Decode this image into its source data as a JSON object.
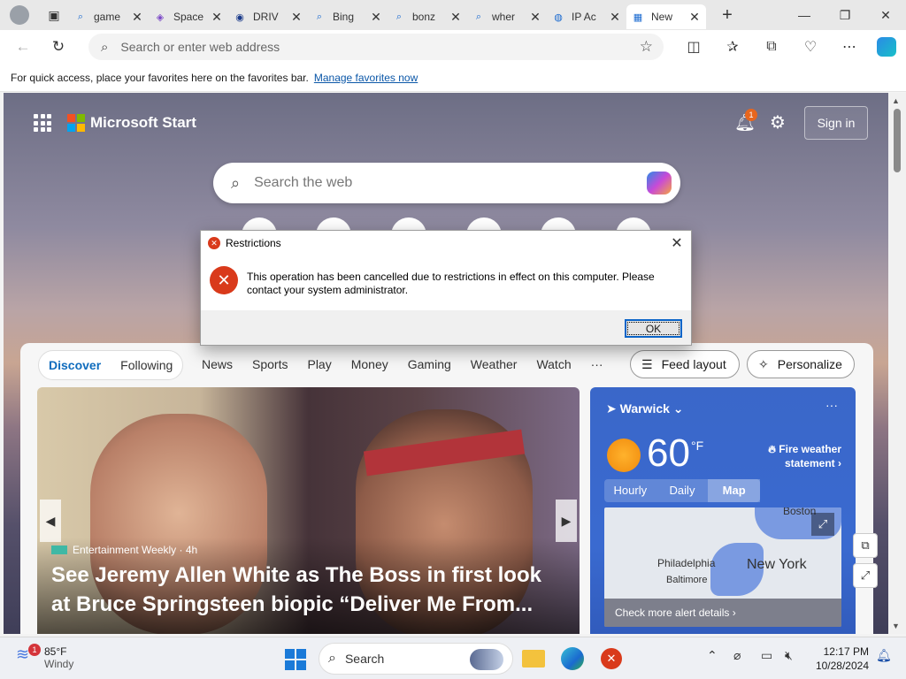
{
  "browser": {
    "tabs": [
      {
        "label": "game",
        "icon": "search-icon"
      },
      {
        "label": "Space",
        "icon": "twitch-icon"
      },
      {
        "label": "DRIV",
        "icon": "circle-icon"
      },
      {
        "label": "Bing",
        "icon": "search-icon"
      },
      {
        "label": "bonz",
        "icon": "search-icon"
      },
      {
        "label": "wher",
        "icon": "search-icon"
      },
      {
        "label": "IP Ac",
        "icon": "globe-icon"
      },
      {
        "label": "New",
        "icon": "newtab-icon",
        "active": true
      }
    ],
    "address_placeholder": "Search or enter web address",
    "favorites_bar_text": "For quick access, place your favorites here on the favorites bar.",
    "favorites_bar_link": "Manage favorites now"
  },
  "start": {
    "brand": "Microsoft Start",
    "notification_count": "1",
    "sign_in": "Sign in",
    "search_placeholder": "Search the web"
  },
  "dialog": {
    "title": "Restrictions",
    "message": "This operation has been cancelled due to restrictions in effect on this computer. Please contact your system administrator.",
    "ok": "OK"
  },
  "feed": {
    "pills": [
      "Discover",
      "Following"
    ],
    "nav": [
      "News",
      "Sports",
      "Play",
      "Money",
      "Gaming",
      "Weather",
      "Watch",
      "···"
    ],
    "feed_layout": "Feed layout",
    "personalize": "Personalize",
    "hero": {
      "source": "Entertainment Weekly · 4h",
      "headline": "See Jeremy Allen White as The Boss in first look at Bruce Springsteen biopic “Deliver Me From..."
    }
  },
  "weather": {
    "location": "Warwick",
    "temp": "60",
    "unit": "°F",
    "alert": "Fire weather statement",
    "tabs": [
      "Hourly",
      "Daily",
      "Map"
    ],
    "map_labels": [
      "Boston",
      "Philadelphia",
      "New York",
      "Baltimore"
    ],
    "alert_link": "Check more alert details"
  },
  "taskbar": {
    "weather_badge": "1",
    "weather_temp": "85°F",
    "weather_cond": "Windy",
    "search": "Search",
    "time": "12:17 PM",
    "date": "10/28/2024"
  }
}
